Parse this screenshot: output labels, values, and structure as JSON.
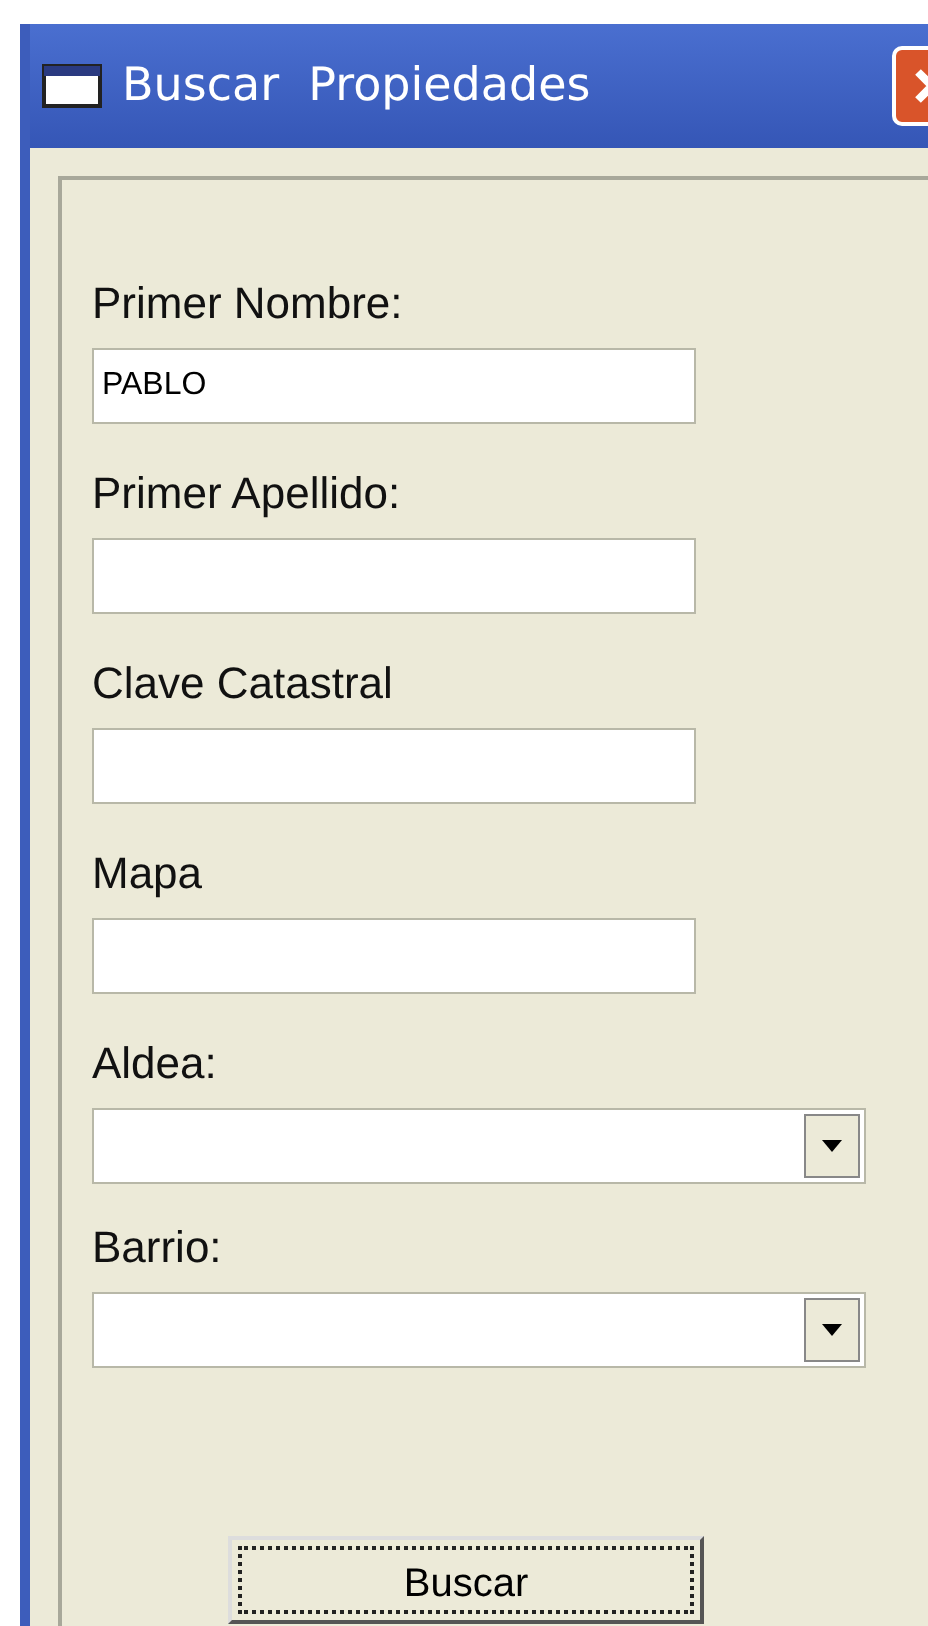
{
  "window": {
    "title": "Buscar  Propiedades"
  },
  "fields": [
    {
      "label": "Primer Nombre:",
      "kind": "text",
      "value": "PABLO"
    },
    {
      "label": "Primer Apellido:",
      "kind": "text"
    },
    {
      "label": "Clave Catastral",
      "kind": "text"
    },
    {
      "label": "Mapa",
      "kind": "text"
    },
    {
      "label": "Aldea:",
      "kind": "combo"
    },
    {
      "label": "Barrio:",
      "kind": "combo"
    }
  ],
  "buttons": [
    {
      "label": "Buscar",
      "focused": true
    }
  ]
}
